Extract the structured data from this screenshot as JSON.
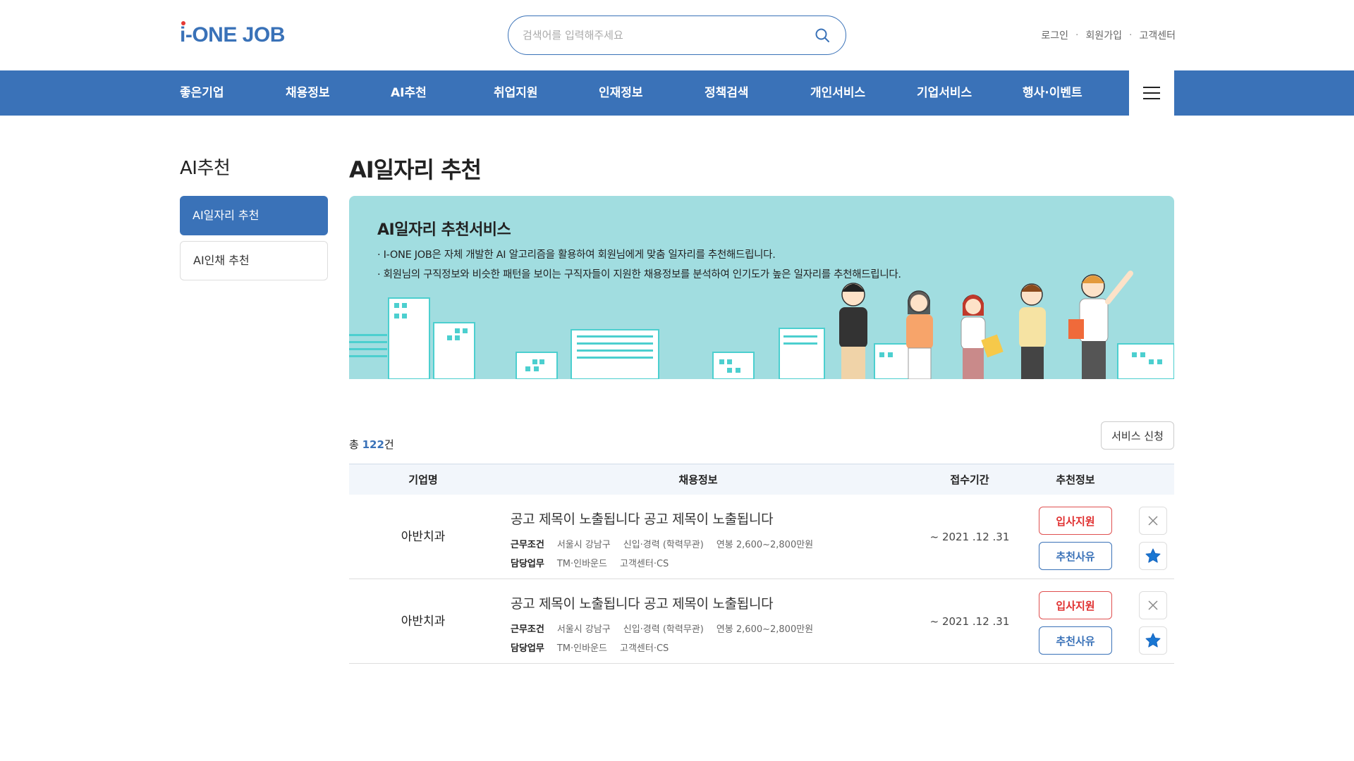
{
  "header": {
    "logo_i": "i",
    "logo_text": "-ONE JOB",
    "search_placeholder": "검색어를 입력해주세요",
    "util_links": [
      "로그인",
      "회원가입",
      "고객센터"
    ],
    "util_sep": "·"
  },
  "gnb": {
    "items": [
      "좋은기업",
      "채용정보",
      "AI추천",
      "취업지원",
      "인재정보",
      "정책검색",
      "개인서비스",
      "기업서비스",
      "행사·이벤트"
    ]
  },
  "sidebar": {
    "title": "AI추천",
    "items": [
      {
        "label": "AI일자리 추천",
        "active": true
      },
      {
        "label": "AI인채 추천",
        "active": false
      }
    ]
  },
  "main": {
    "title": "AI일자리 추천",
    "banner": {
      "heading": "AI일자리 추천서비스",
      "line1": "· I-ONE JOB은 자체 개발한 AI 알고리즘을 활용하여 회원님에게 맞춤 일자리를 추천해드립니다.",
      "line2": "· 회원님의 구직정보와 비슷한 패턴을 보이는 구직자들이 지원한 채용정보를 분석하여 인기도가 높은 일자리를 추천해드립니다."
    },
    "total_prefix": "총 ",
    "total_count": "122",
    "total_suffix": "건",
    "service_button": "서비스 신청",
    "table": {
      "headers": [
        "기업명",
        "채용정보",
        "접수기간",
        "추천정보"
      ],
      "rows": [
        {
          "company": "아반치과",
          "title": "공고 제목이 노출됩니다 공고 제목이 노출됩니다",
          "cond_label": "근무조건",
          "cond_values": [
            "서울시 강남구",
            "신입·경력 (학력무관)",
            "연봉 2,600~2,800만원"
          ],
          "duty_label": "담당업무",
          "duty_values": [
            "TM·인바운드",
            "고객센터·CS"
          ],
          "period": "~ 2021 .12 .31",
          "apply": "입사지원",
          "reason": "추천사유"
        },
        {
          "company": "아반치과",
          "title": "공고 제목이 노출됩니다 공고 제목이 노출됩니다",
          "cond_label": "근무조건",
          "cond_values": [
            "서울시 강남구",
            "신입·경력 (학력무관)",
            "연봉 2,600~2,800만원"
          ],
          "duty_label": "담당업무",
          "duty_values": [
            "TM·인바운드",
            "고객센터·CS"
          ],
          "period": "~ 2021 .12 .31",
          "apply": "입사지원",
          "reason": "추천사유"
        }
      ]
    }
  },
  "colors": {
    "brand": "#3a72b8",
    "banner_bg": "#a1dde0",
    "apply_red": "#e03030",
    "star_blue": "#1976d2"
  },
  "icons": [
    "search-icon",
    "hamburger-icon",
    "close-icon",
    "star-icon"
  ]
}
